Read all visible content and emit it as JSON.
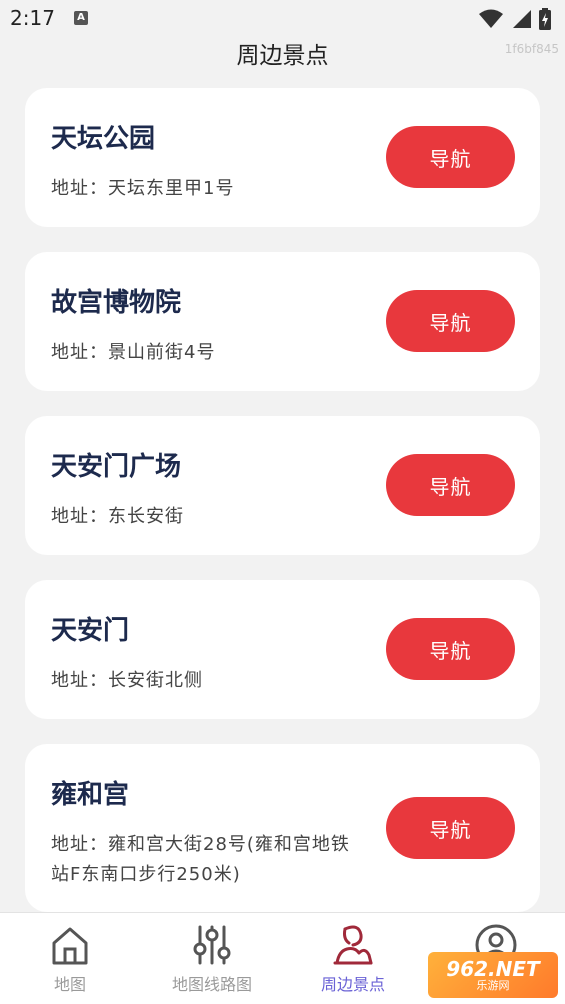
{
  "status": {
    "time": "2:17",
    "notif_icon": "A"
  },
  "header": {
    "title": "周边景点",
    "build": "1f6bf845"
  },
  "nav_button_label": "导航",
  "places": [
    {
      "name": "天坛公园",
      "address": "地址：天坛东里甲1号"
    },
    {
      "name": "故宫博物院",
      "address": "地址：景山前街4号"
    },
    {
      "name": "天安门广场",
      "address": "地址：东长安街"
    },
    {
      "name": "天安门",
      "address": "地址：长安街北侧"
    },
    {
      "name": "雍和宫",
      "address": "地址：雍和宫大街28号(雍和宫地铁站F东南口步行250米)"
    }
  ],
  "tabs": [
    {
      "label": "地图",
      "icon": "home-icon",
      "active": false
    },
    {
      "label": "地图线路图",
      "icon": "sliders-icon",
      "active": false
    },
    {
      "label": "周边景点",
      "icon": "landmark-icon",
      "active": true
    },
    {
      "label": "我的",
      "icon": "profile-icon",
      "active": false
    }
  ],
  "watermark": {
    "main": "962.NET",
    "sub": "乐游网"
  },
  "colors": {
    "accent": "#e8383d",
    "active_tab": "#6b63d6",
    "title_text": "#1d2a4d"
  }
}
